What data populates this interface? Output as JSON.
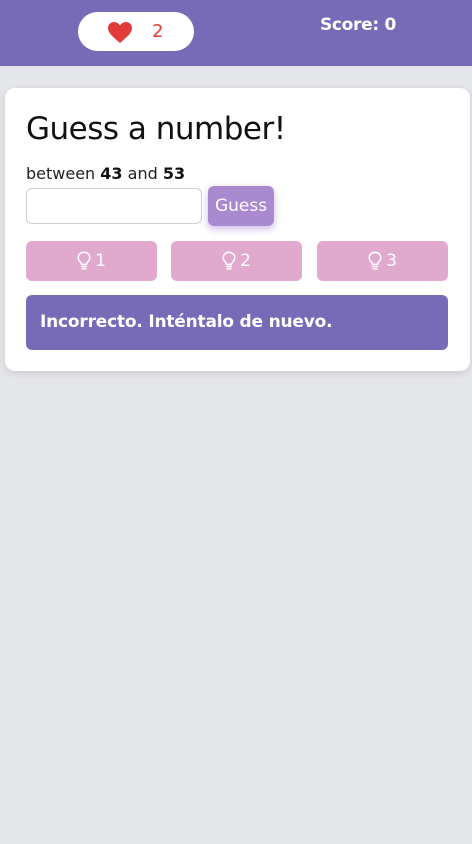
{
  "header": {
    "lives": "2",
    "score_text": "Score: 0"
  },
  "game": {
    "title": "Guess a number!",
    "range_prefix": "between",
    "range_min": "43",
    "range_joiner": "and",
    "range_max": "53",
    "input_value": "",
    "guess_label": "Guess",
    "hints": [
      {
        "label": "1",
        "icon": "lightbulb-icon"
      },
      {
        "label": "2",
        "icon": "lightbulb-icon"
      },
      {
        "label": "3",
        "icon": "lightbulb-icon"
      }
    ],
    "feedback": "Incorrecto. Inténtalo de nuevo."
  },
  "colors": {
    "header_bg": "#776bb7",
    "heart": "#e23b3b",
    "guess_button": "#a98ad0",
    "hint_button": "#e0a9cd",
    "feedback_bg": "#776bb7",
    "page_bg": "#e5e6ea"
  }
}
